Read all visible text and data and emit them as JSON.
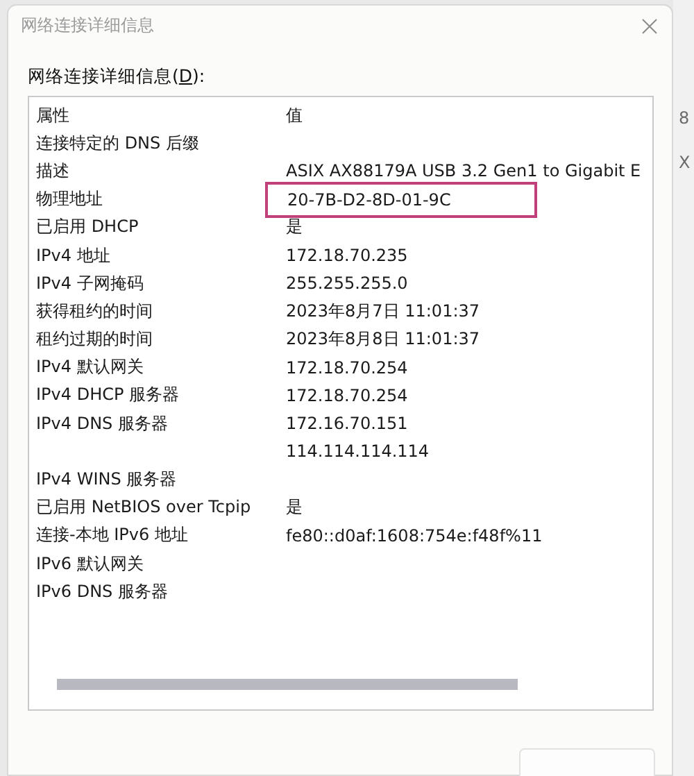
{
  "window": {
    "title": "网络连接详细信息"
  },
  "background_window": {
    "texts": [
      "8",
      "X"
    ]
  },
  "list_label": {
    "text": "网络连接详细信息(",
    "mnemonic": "D",
    "suffix": "):"
  },
  "table": {
    "columns": [
      "属性",
      "值"
    ],
    "rows": [
      {
        "property": "连接特定的 DNS 后缀",
        "value": "",
        "highlighted": false
      },
      {
        "property": "描述",
        "value": "ASIX AX88179A USB 3.2 Gen1 to Gigabit E",
        "highlighted": false
      },
      {
        "property": "物理地址",
        "value": "20-7B-D2-8D-01-9C",
        "highlighted": true
      },
      {
        "property": "已启用 DHCP",
        "value": "是",
        "highlighted": false
      },
      {
        "property": "IPv4 地址",
        "value": "172.18.70.235",
        "highlighted": false
      },
      {
        "property": "IPv4 子网掩码",
        "value": "255.255.255.0",
        "highlighted": false
      },
      {
        "property": "获得租约的时间",
        "value": "2023年8月7日 11:01:37",
        "highlighted": false
      },
      {
        "property": "租约过期的时间",
        "value": "2023年8月8日 11:01:37",
        "highlighted": false
      },
      {
        "property": "IPv4 默认网关",
        "value": "172.18.70.254",
        "highlighted": false
      },
      {
        "property": "IPv4 DHCP 服务器",
        "value": "172.18.70.254",
        "highlighted": false
      },
      {
        "property": "IPv4 DNS 服务器",
        "value": "172.16.70.151",
        "highlighted": false
      },
      {
        "property": "",
        "value": "114.114.114.114",
        "highlighted": false
      },
      {
        "property": "IPv4 WINS 服务器",
        "value": "",
        "highlighted": false
      },
      {
        "property": "已启用 NetBIOS over Tcpip",
        "value": "是",
        "highlighted": false
      },
      {
        "property": "连接-本地 IPv6 地址",
        "value": "fe80::d0af:1608:754e:f48f%11",
        "highlighted": false
      },
      {
        "property": "IPv6 默认网关",
        "value": "",
        "highlighted": false
      },
      {
        "property": "IPv6 DNS 服务器",
        "value": "",
        "highlighted": false
      }
    ]
  }
}
